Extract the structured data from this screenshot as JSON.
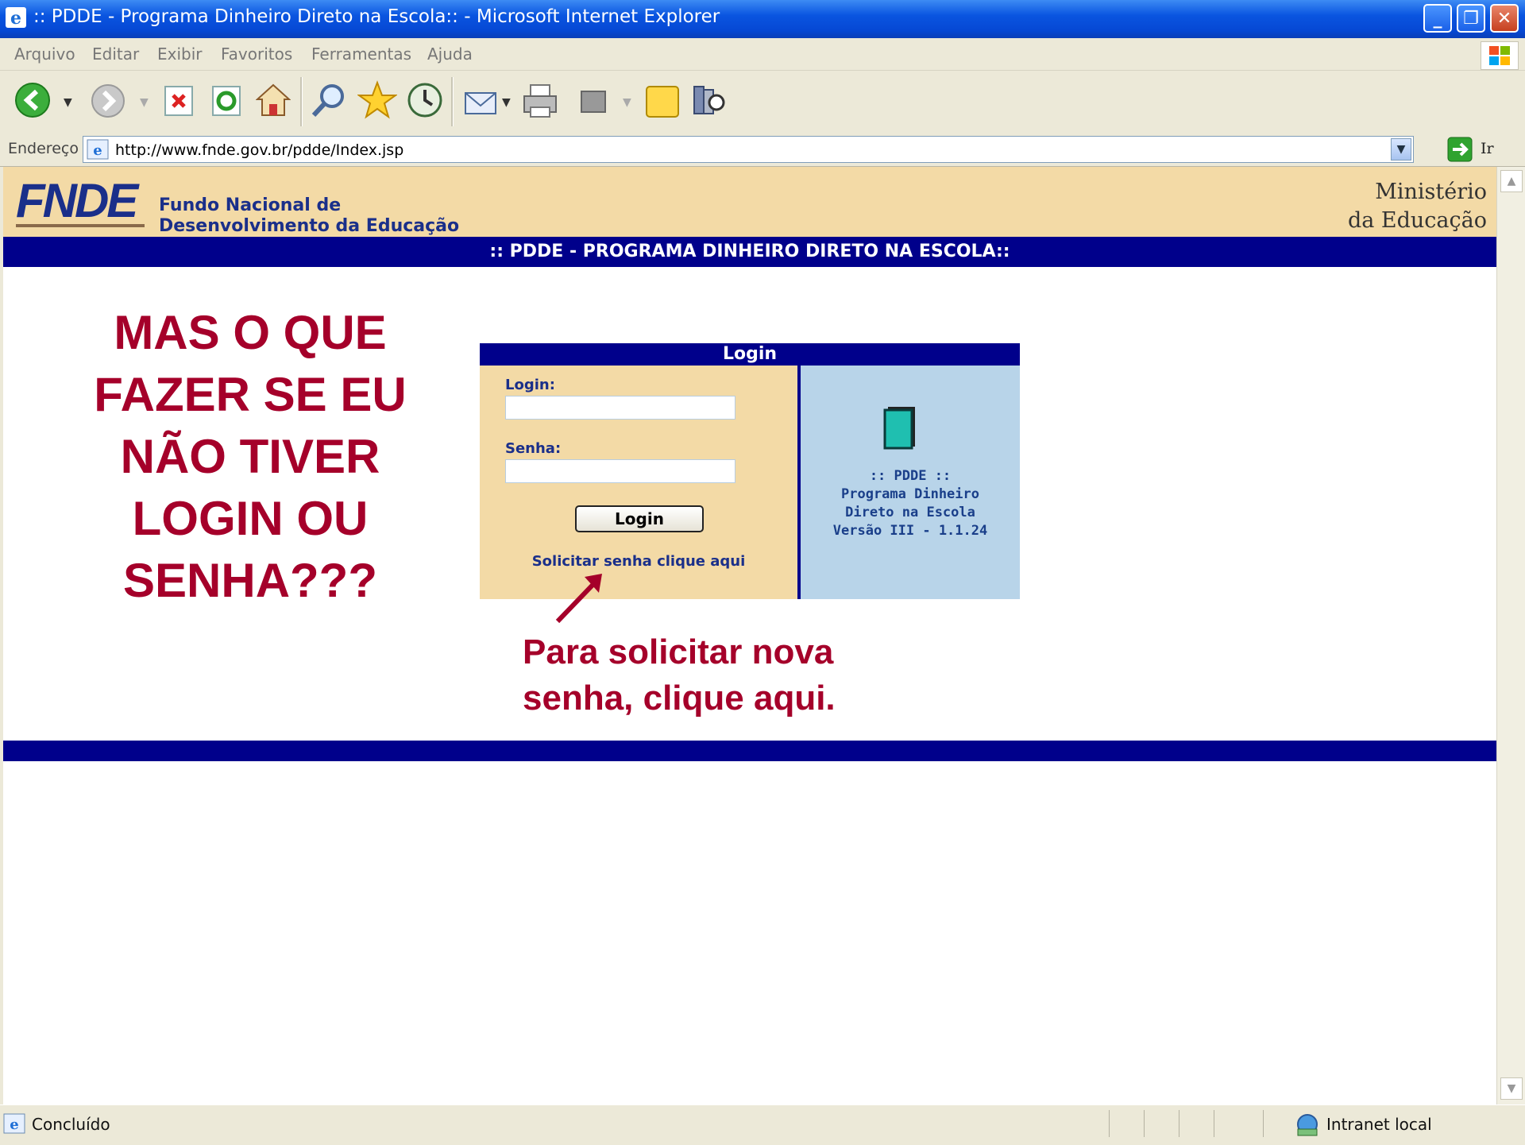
{
  "window": {
    "title": ":: PDDE - Programa Dinheiro Direto na Escola:: - Microsoft Internet Explorer"
  },
  "menu": [
    "Arquivo",
    "Editar",
    "Exibir",
    "Favoritos",
    "Ferramentas",
    "Ajuda"
  ],
  "address": {
    "label": "Endereço",
    "url": "http://www.fnde.gov.br/pdde/Index.jsp",
    "go": "Ir"
  },
  "header": {
    "logo": "FNDE",
    "org_line1": "Fundo Nacional de",
    "org_line2": "Desenvolvimento da Educação",
    "ministry_line1": "Ministério",
    "ministry_line2": "da Educação",
    "banner": ":: PDDE - PROGRAMA DINHEIRO DIRETO NA ESCOLA::"
  },
  "login": {
    "title": "Login",
    "login_label": "Login:",
    "login_value": "",
    "password_label": "Senha:",
    "password_value": "",
    "button": "Login",
    "request_link": "Solicitar senha clique aqui",
    "info_line1": ":: PDDE ::",
    "info_line2": "Programa Dinheiro",
    "info_line3": "Direto na Escola",
    "info_line4": "Versão III - 1.1.24"
  },
  "annotation": {
    "question_lines": [
      "MAS O QUE",
      "FAZER SE EU",
      "NÃO TIVER",
      "LOGIN OU",
      "SENHA???"
    ],
    "hint_line1": "Para solicitar nova",
    "hint_line2": "senha, clique aqui."
  },
  "status": {
    "text": "Concluído",
    "zone": "Intranet local"
  },
  "colors": {
    "accent": "#00008b",
    "header_bg": "#f3daa6",
    "annotation": "#a5002a",
    "info_bg": "#b8d4e9"
  }
}
